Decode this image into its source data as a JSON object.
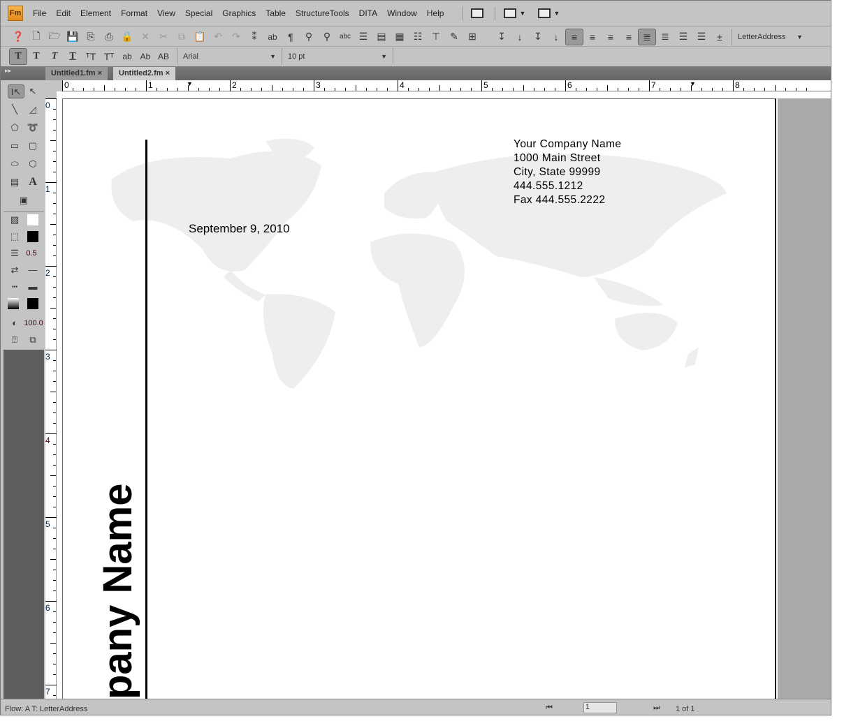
{
  "app": {
    "logo": "Fm"
  },
  "menu": [
    "File",
    "Edit",
    "Element",
    "Format",
    "View",
    "Special",
    "Graphics",
    "Table",
    "StructureTools",
    "DITA",
    "Window",
    "Help"
  ],
  "toolbar": {
    "paragraph_tag": "LetterAddress"
  },
  "format_bar": {
    "font": "Arial",
    "size": "10 pt",
    "styles": [
      "T",
      "T",
      "T",
      "T",
      "ab",
      "Ab",
      "AB"
    ]
  },
  "tabs": [
    {
      "label": "Untitled1.fm",
      "active": false
    },
    {
      "label": "Untitled2.fm",
      "active": true
    }
  ],
  "toolbox": {
    "line_width": "0.5",
    "tint": "100.0"
  },
  "ruler": {
    "h": [
      "0",
      "1",
      "2",
      "3",
      "4",
      "5",
      "6",
      "7",
      "8"
    ],
    "v": [
      "0",
      "1",
      "2",
      "3",
      "4",
      "5",
      "6",
      "7"
    ]
  },
  "document": {
    "address": [
      "Your Company Name",
      "1000 Main Street",
      "City, State 99999",
      "444.555.1212",
      "Fax 444.555.2222"
    ],
    "date": "September 9, 2010",
    "vertical_name": "pany Name"
  },
  "status": {
    "flow": "Flow: A  T: LetterAddress",
    "page_field": "1",
    "page_count": "1 of 1"
  }
}
